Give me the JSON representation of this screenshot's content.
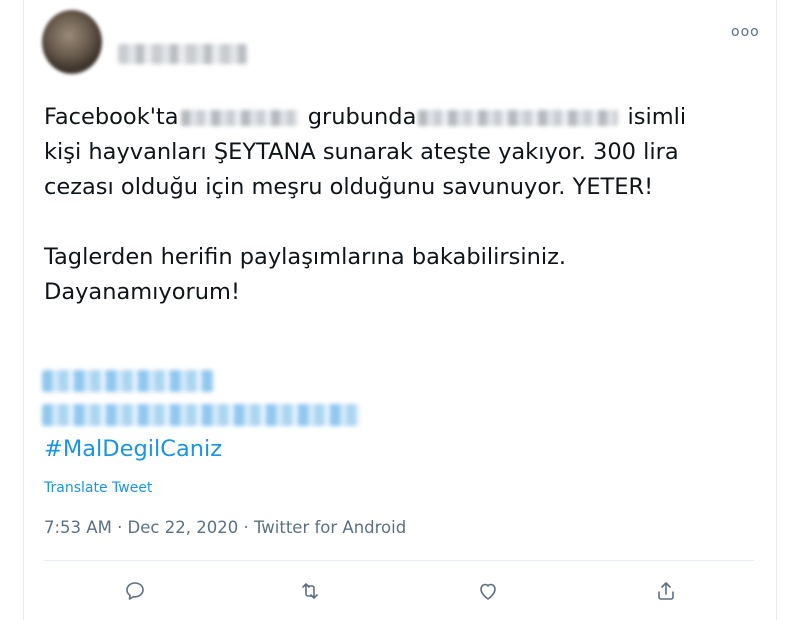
{
  "tweet": {
    "more_label": "ooo",
    "text": {
      "line1_a": "Facebook'ta",
      "line1_b": "grubunda",
      "line1_c": "isimli",
      "line2": "kişi hayvanları ŞEYTANA sunarak ateşte yakıyor. 300 lira",
      "line3": "cezası olduğu için meşru olduğunu savunuyor. YETER!",
      "line4": "Taglerden herifin paylaşımlarına bakabilirsiniz.",
      "line5": "Dayanamıyorum!"
    },
    "hashtag": "#MalDegilCaniz",
    "translate_label": "Translate Tweet",
    "meta": "7:53 AM · Dec 22, 2020 · Twitter for Android"
  },
  "actions": [
    {
      "name": "reply-icon"
    },
    {
      "name": "retweet-icon"
    },
    {
      "name": "like-icon"
    },
    {
      "name": "share-icon"
    }
  ],
  "colors": {
    "link": "#1b95e0",
    "muted": "#5b7083",
    "text": "#0f1419"
  }
}
